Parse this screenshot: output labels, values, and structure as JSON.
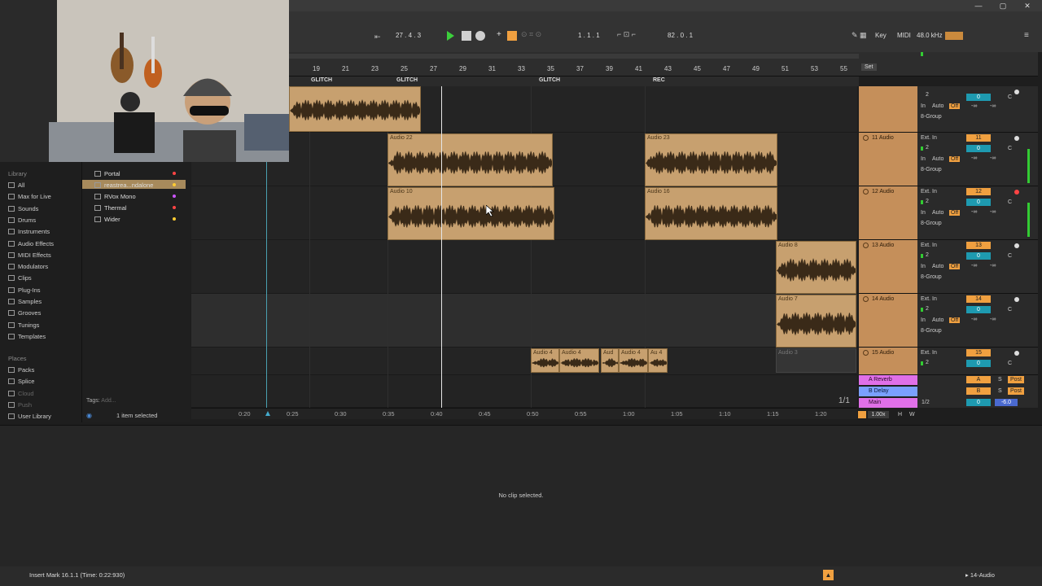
{
  "window": {
    "minimize": "—",
    "maximize": "▢",
    "close": "✕"
  },
  "transport": {
    "position": "27 .  4 .  3",
    "position2": "1 .  1 .  1",
    "tempo_field": "82 .  0 .  1",
    "key_label": "Key",
    "midi_label": "MIDI",
    "sample_rate": "48.0 kHz"
  },
  "ruler": {
    "marks": [
      "19",
      "21",
      "23",
      "25",
      "27",
      "29",
      "31",
      "33",
      "35",
      "37",
      "39",
      "41",
      "43",
      "45",
      "47",
      "49",
      "51",
      "53",
      "55"
    ],
    "set_label": "Set"
  },
  "locators": [
    "GLITCH",
    "GLITCH",
    "GLITCH",
    "REC"
  ],
  "clips": {
    "top": "",
    "audio22": "Audio 22",
    "audio23": "Audio 23",
    "audio10": "Audio 10",
    "audio16": "Audio 16",
    "audio8": "Audio 8",
    "audio7": "Audio 7",
    "audio3": "Audio 3",
    "small": [
      "Audio 4",
      "Audio 4",
      "Aud",
      "Audio 4",
      "Au 4"
    ]
  },
  "tracks": [
    {
      "name": "",
      "num": "",
      "input": "",
      "ch": "2",
      "in": "In",
      "auto": "Auto",
      "off": "Off",
      "group": "8-Group",
      "vol": "0",
      "pan": "C",
      "send": "-∞"
    },
    {
      "name": "11 Audio",
      "num": "11",
      "input": "Ext. In",
      "ch": "2",
      "in": "In",
      "auto": "Auto",
      "off": "Off",
      "group": "8-Group",
      "vol": "0",
      "pan": "C",
      "send": "-∞"
    },
    {
      "name": "12 Audio",
      "num": "12",
      "input": "Ext. In",
      "ch": "2",
      "in": "In",
      "auto": "Auto",
      "off": "Off",
      "group": "8-Group",
      "vol": "0",
      "pan": "C",
      "send": "-∞"
    },
    {
      "name": "13 Audio",
      "num": "13",
      "input": "Ext. In",
      "ch": "2",
      "in": "In",
      "auto": "Auto",
      "off": "Off",
      "group": "8-Group",
      "vol": "0",
      "pan": "C",
      "send": "-∞"
    },
    {
      "name": "14 Audio",
      "num": "14",
      "input": "Ext. In",
      "ch": "2",
      "in": "In",
      "auto": "Auto",
      "off": "Off",
      "group": "8-Group",
      "vol": "0",
      "pan": "C",
      "send": "-∞"
    },
    {
      "name": "15 Audio",
      "num": "15",
      "input": "Ext. In",
      "ch": "2",
      "in": "",
      "auto": "",
      "off": "",
      "group": "",
      "vol": "0",
      "pan": "C",
      "send": ""
    }
  ],
  "returns": {
    "a": "A Reverb",
    "a_letter": "A",
    "b": "B Delay",
    "b_letter": "B",
    "main": "Main",
    "main_ratio": "1/2",
    "main_vol": "0",
    "main_db": "-6.0",
    "solo": "S",
    "post": "Post",
    "fraction": "1/1"
  },
  "sidebar": {
    "library_header": "Library",
    "items": [
      "All",
      "Max for Live",
      "Sounds",
      "Drums",
      "Instruments",
      "Audio Effects",
      "MIDI Effects",
      "Modulators",
      "Clips",
      "Plug-Ins",
      "Samples",
      "Grooves",
      "Tunings",
      "Templates"
    ],
    "places_header": "Places",
    "places": [
      "Packs",
      "Splice",
      "Cloud",
      "Push",
      "User Library"
    ]
  },
  "browser": {
    "items": [
      "Portal",
      "reastrea...ndalone",
      "RVox Mono",
      "Thermal",
      "Wider"
    ],
    "tags_label": "Tags:",
    "tags_placeholder": "Add...",
    "selected_count": "1 item selected"
  },
  "timebar": {
    "labels": [
      "0:20",
      "0:25",
      "0:30",
      "0:35",
      "0:40",
      "0:45",
      "0:50",
      "0:55",
      "1:00",
      "1:05",
      "1:10",
      "1:15",
      "1:20"
    ],
    "zoom": "1.00x",
    "h": "H",
    "w": "W"
  },
  "detail": {
    "empty_message": "No clip selected."
  },
  "status": {
    "message": "Insert Mark 16.1.1 (Time: 0:22:930)",
    "track": "14-Audio"
  },
  "colors": {
    "clip": "#c7a06f",
    "track": "#c58f5a",
    "accent": "#f0a040",
    "play": "#3ccf3c",
    "reverb": "#e070e8",
    "delay": "#7aa0ff"
  }
}
